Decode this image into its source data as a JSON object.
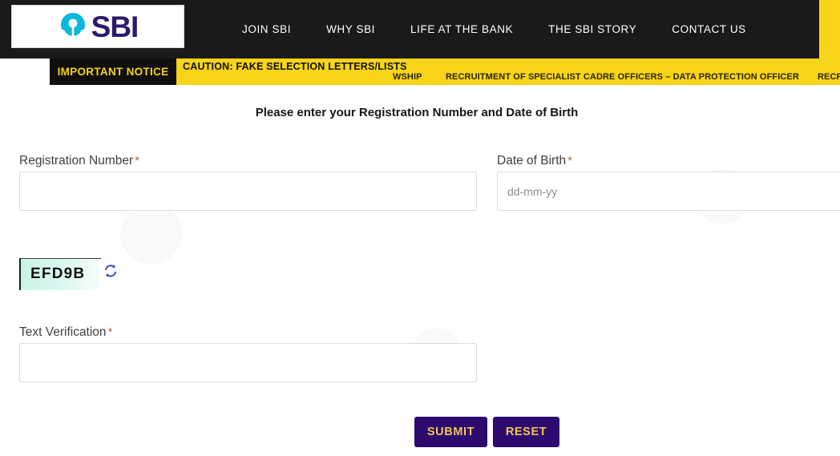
{
  "header": {
    "logo": {
      "text": "SBI",
      "mark_icon": "sbi-keyhole-logo-icon",
      "mark_color": "#0bb7dd",
      "text_color": "#2b1a6b"
    },
    "nav": [
      {
        "label": "JOIN SBI"
      },
      {
        "label": "WHY SBI"
      },
      {
        "label": "LIFE AT THE BANK"
      },
      {
        "label": "THE SBI STORY"
      },
      {
        "label": "CONTACT US"
      }
    ]
  },
  "notice": {
    "badge": "IMPORTANT NOTICE",
    "caution": "CAUTION: FAKE SELECTION LETTERS/LISTS",
    "ticker": [
      "WSHIP",
      "RECRUITMENT OF SPECIALIST CADRE OFFICERS – DATA PROTECTION OFFICER",
      "RECR"
    ],
    "bg_color": "#f7d417",
    "badge_bg": "#100f0e",
    "badge_text_color": "#f7d417"
  },
  "form": {
    "title": "Please enter your Registration Number and Date of Birth",
    "registration": {
      "label": "Registration Number",
      "required_marker": "*",
      "value": "",
      "placeholder": ""
    },
    "dob": {
      "label": "Date of Birth",
      "required_marker": "*",
      "value": "",
      "placeholder": "dd-mm-yy"
    },
    "captcha": {
      "code": "EFD9B",
      "refresh_icon": "refresh-icon",
      "refresh_color": "#3b4fc4"
    },
    "text_verification": {
      "label": "Text Verification",
      "required_marker": "*",
      "value": "",
      "placeholder": ""
    },
    "buttons": {
      "submit": "SUBMIT",
      "reset": "RESET",
      "bg_color": "#2c0a6e",
      "text_color": "#f0c75a"
    }
  }
}
